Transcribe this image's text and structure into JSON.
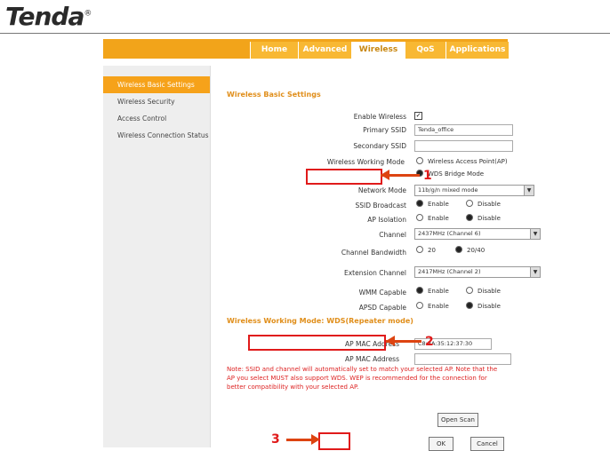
{
  "brand": {
    "logo": "Tenda",
    "reg": "®"
  },
  "nav": {
    "tabs": [
      "Home",
      "Advanced",
      "Wireless",
      "QoS",
      "Applications"
    ],
    "active": "Wireless"
  },
  "sidebar": {
    "items": [
      "Wireless Basic Settings",
      "Wireless Security",
      "Access Control",
      "Wireless Connection Status"
    ]
  },
  "form": {
    "title": "Wireless Basic Settings",
    "enable_wireless_label": "Enable Wireless",
    "primary_ssid_label": "Primary SSID",
    "primary_ssid_value": "Tenda_office",
    "secondary_ssid_label": "Secondary SSID",
    "secondary_ssid_value": "",
    "working_mode_label": "Wireless Working Mode",
    "mode_ap": "Wireless Access Point(AP)",
    "mode_wds": "WDS Bridge Mode",
    "network_mode_label": "Network Mode",
    "network_mode_value": "11b/g/n mixed mode",
    "ssid_broadcast_label": "SSID Broadcast",
    "ap_isolation_label": "AP Isolation",
    "channel_label": "Channel",
    "channel_value": "2437MHz (Channel 6)",
    "bandwidth_label": "Channel Bandwidth",
    "bw_20": "20",
    "bw_2040": "20/40",
    "ext_channel_label": "Extension Channel",
    "ext_channel_value": "2417MHz (Channel 2)",
    "wmm_label": "WMM Capable",
    "apsd_label": "APSD Capable",
    "enable": "Enable",
    "disable": "Disable"
  },
  "wds": {
    "title": "Wireless Working Mode: WDS(Repeater mode)",
    "ap_mac_label_1": "AP MAC Address",
    "ap_mac_value_1": "C8:3A:35:12:37:30",
    "ap_mac_label_2": "AP MAC Address",
    "ap_mac_value_2": "",
    "note": "Note: SSID and channel will automatically set to match your selected AP. Note that the AP you select MUST also support WDS. WEP is recommended for the connection for better compatibility with your selected AP.",
    "open_scan": "Open Scan",
    "ok": "OK",
    "cancel": "Cancel"
  },
  "annotations": {
    "n1": "1",
    "n2": "2",
    "n3": "3",
    "color": "#e01a1a"
  }
}
